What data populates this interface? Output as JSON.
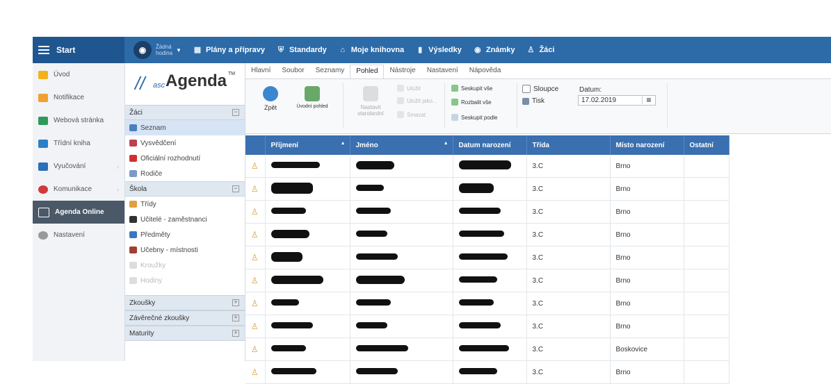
{
  "topbar": {
    "start": "Start",
    "lesson_line1": "Žádná",
    "lesson_line2": "hodina",
    "nav": [
      {
        "label": "Plány a přípravy",
        "icon": "calendar-icon"
      },
      {
        "label": "Standardy",
        "icon": "shield-icon"
      },
      {
        "label": "Moje knihovna",
        "icon": "library-icon"
      },
      {
        "label": "Výsledky",
        "icon": "bar-chart-icon"
      },
      {
        "label": "Známky",
        "icon": "grade-icon"
      },
      {
        "label": "Žáci",
        "icon": "students-icon"
      }
    ]
  },
  "sidebar": {
    "items": [
      {
        "label": "Úvod",
        "color": "#f2b21a"
      },
      {
        "label": "Notifikace",
        "color": "#f0a030"
      },
      {
        "label": "Webová stránka",
        "color": "#2e9a5a"
      },
      {
        "label": "Třídní kniha",
        "color": "#2a7fc8"
      },
      {
        "label": "Vyučování",
        "color": "#2a6fb8"
      },
      {
        "label": "Komunikace",
        "color": "#d23a3a"
      },
      {
        "label": "Agenda Online",
        "color": "#ffffff"
      },
      {
        "label": "Nastavení",
        "color": "#999999"
      }
    ]
  },
  "logo": {
    "asc": "asc",
    "agenda": "Agenda",
    "tm": "TM"
  },
  "panel": {
    "zaci_header": "Žáci",
    "zaci_items": [
      "Seznam",
      "Vysvědčení",
      "Oficiální rozhodnutí",
      "Rodiče"
    ],
    "skola_header": "Škola",
    "skola_items": [
      "Třídy",
      "Učitelé - zaměstnanci",
      "Předměty",
      "Učebny - místnosti",
      "Kroužky",
      "Hodiny"
    ],
    "bottom_headers": [
      "Zkoušky",
      "Závěrečné zkoušky",
      "Maturity"
    ]
  },
  "tabs": [
    "Hlavní",
    "Soubor",
    "Seznamy",
    "Pohled",
    "Nástroje",
    "Nastavení",
    "Nápověda"
  ],
  "ribbon": {
    "back": "Zpět",
    "home_view": "Úvodní pohled",
    "set_standard_1": "Nastavit",
    "set_standard_2": "standardní",
    "save": "Uložit",
    "save_as": "Uložit jako...",
    "delete": "Smazat",
    "group_all": "Seskupit vše",
    "expand_all": "Rozbalit vše",
    "group_by": "Seskupit podle",
    "columns": "Sloupce",
    "print": "Tisk",
    "date_label": "Datum:",
    "date_value": "17.02.2019"
  },
  "table": {
    "columns": [
      "Příjmení",
      "Jméno",
      "Datum narození",
      "Třída",
      "Místo narození",
      "Ostatní"
    ],
    "rows": [
      {
        "trida": "3.C",
        "misto": "Brno"
      },
      {
        "trida": "3.C",
        "misto": "Brno"
      },
      {
        "trida": "3.C",
        "misto": "Brno"
      },
      {
        "trida": "3.C",
        "misto": "Brno"
      },
      {
        "trida": "3.C",
        "misto": "Brno"
      },
      {
        "trida": "3.C",
        "misto": "Brno"
      },
      {
        "trida": "3.C",
        "misto": "Brno"
      },
      {
        "trida": "3.C",
        "misto": "Brno"
      },
      {
        "trida": "3.C",
        "misto": "Boskovice"
      },
      {
        "trida": "3.C",
        "misto": "Brno"
      }
    ]
  }
}
